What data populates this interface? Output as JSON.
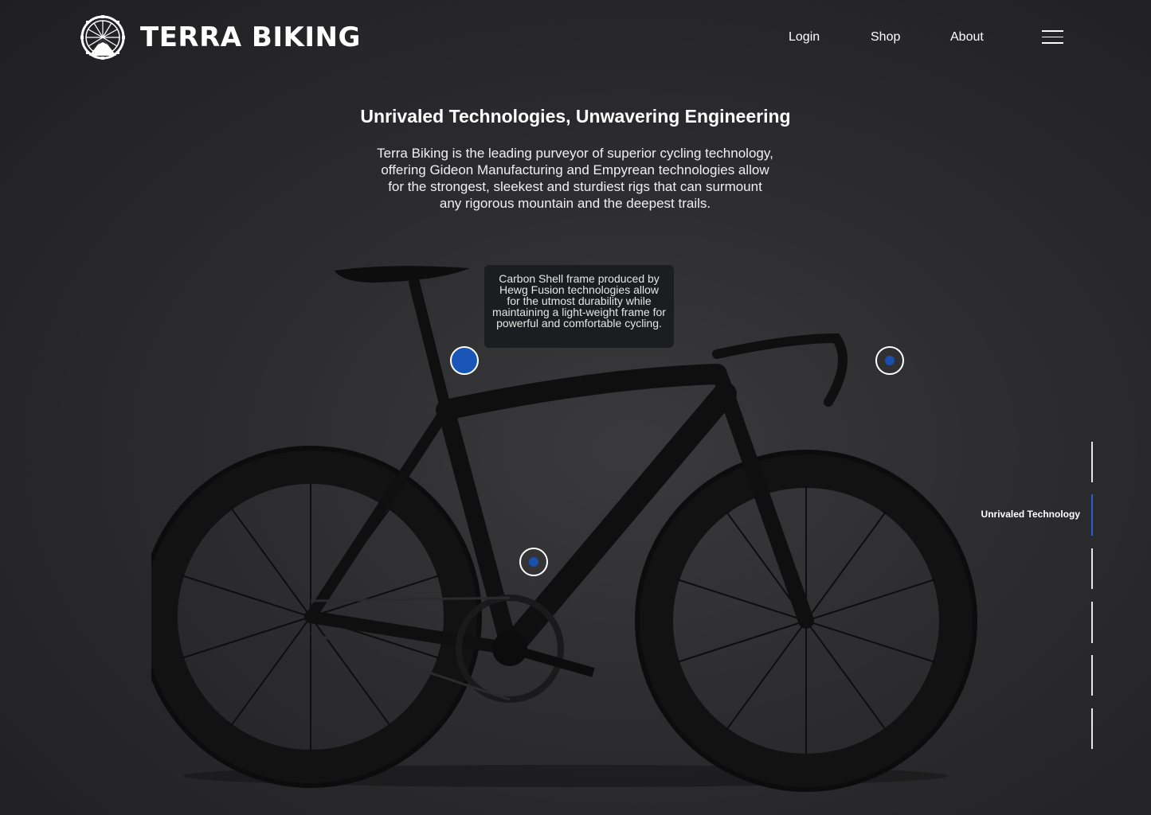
{
  "brand": {
    "name": "TERRA BIKING",
    "logo_icon": "wheel-mountain-logo-icon"
  },
  "nav": {
    "login": "Login",
    "shop": "Shop",
    "about": "About",
    "menu_icon": "hamburger-menu-icon"
  },
  "hero": {
    "title": "Unrivaled Technologies, Unwavering Engineering",
    "body": "Terra Biking is the leading purveyor of superior cycling technology, offering Gideon Manufacturing and Empyrean technologies allow for the strongest, sleekest and sturdiest rigs that can surmount any rigorous mountain and the deepest trails."
  },
  "tooltip": {
    "text": "Carbon Shell frame produced by Hewg Fusion technologies allow for the utmost durability while maintaining a light-weight frame for powerful and comfortable cycling."
  },
  "side_nav": {
    "active_label": "Unrivaled Technology"
  },
  "colors": {
    "accent": "#1a56b8",
    "background": "#2c2c2e"
  }
}
